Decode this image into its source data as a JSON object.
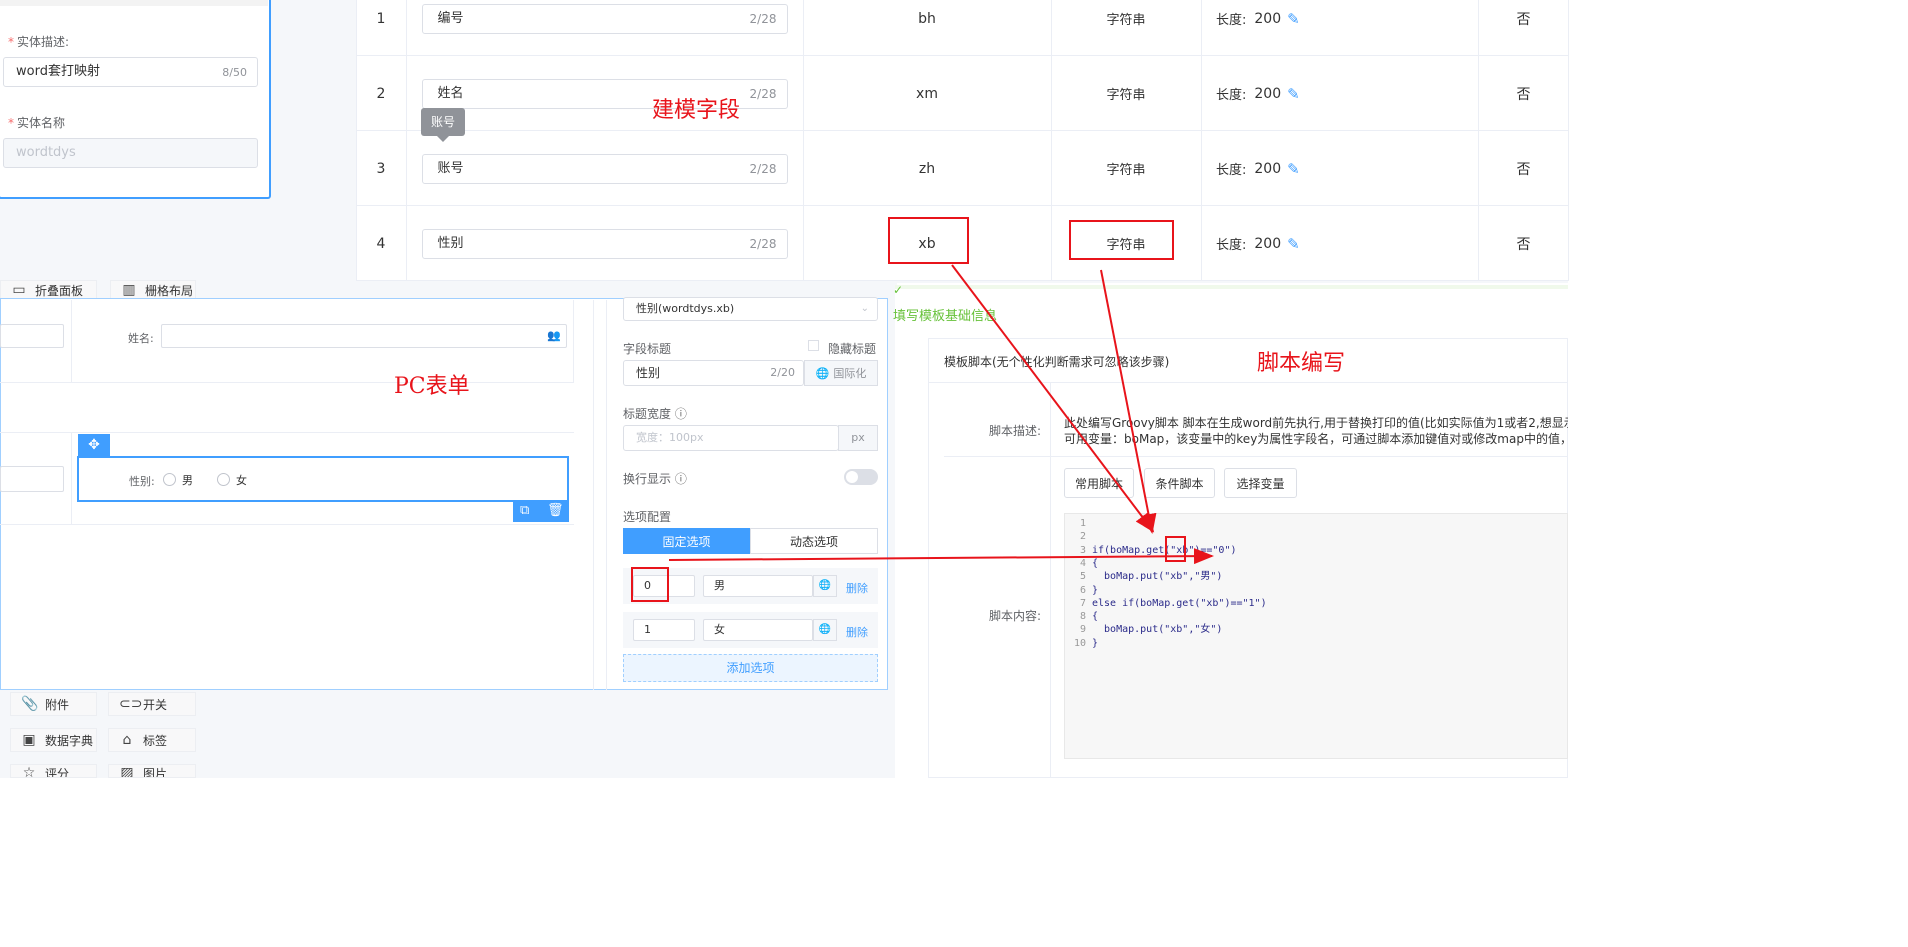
{
  "entity": {
    "desc_label": "实体描述:",
    "desc_value": "word套打映射",
    "desc_count": "8/50",
    "name_label": "实体名称",
    "name_value": "wordtdys"
  },
  "fields": {
    "rows": [
      {
        "index": "1",
        "label": "编号",
        "count": "2/28",
        "code": "bh",
        "type": "字符串",
        "length_label": "长度:",
        "length": "200",
        "required": "否"
      },
      {
        "index": "2",
        "label": "姓名",
        "count": "2/28",
        "code": "xm",
        "type": "字符串",
        "length_label": "长度:",
        "length": "200",
        "required": "否"
      },
      {
        "index": "3",
        "label": "账号",
        "count": "2/28",
        "code": "zh",
        "type": "字符串",
        "length_label": "长度:",
        "length": "200",
        "required": "否"
      },
      {
        "index": "4",
        "label": "性别",
        "count": "2/28",
        "code": "xb",
        "type": "字符串",
        "length_label": "长度:",
        "length": "200",
        "required": "否"
      }
    ],
    "tooltip": "账号"
  },
  "annotations": {
    "modeling": "建模字段",
    "pc_form": "PC表单",
    "script": "脚本编写"
  },
  "designer": {
    "components_top": [
      "折叠面板",
      "栅格布局"
    ],
    "components_bottom": [
      "附件",
      "开关",
      "数据字典",
      "标签",
      "评分",
      "图片"
    ],
    "name_label": "姓名:",
    "gender_label": "性别:",
    "radio_options": [
      "男",
      "女"
    ]
  },
  "props": {
    "bound_field": "性别(wordtdys.xb)",
    "field_title_label": "字段标题",
    "hide_title_label": "隐藏标题",
    "field_title_value": "性别",
    "field_title_count": "2/20",
    "i18n": "国际化",
    "title_width_label": "标题宽度",
    "title_width_placeholder": "宽度：100px",
    "unit": "px",
    "wrap_label": "换行显示",
    "options_label": "选项配置",
    "tab_fixed": "固定选项",
    "tab_dynamic": "动态选项",
    "options": [
      {
        "value": "0",
        "label": "男",
        "delete": "删除"
      },
      {
        "value": "1",
        "label": "女",
        "delete": "删除"
      }
    ],
    "add_option": "添加选项"
  },
  "script": {
    "step_title": "填写模板基础信息",
    "card_title": "模板脚本(无个性化判断需求可忽略该步骤)",
    "desc_label": "脚本描述:",
    "desc_line1": "此处编写Groovy脚本 脚本在生成word前先执行,用于替换打印的值(比如实际值为1或者2,想显示的值",
    "desc_line2": "可用变量：boMap，该变量中的key为属性字段名，可通过脚本添加键值对或修改map中的值，如：",
    "buttons": [
      "常用脚本",
      "条件脚本",
      "选择变量"
    ],
    "content_label": "脚本内容:",
    "code": [
      {
        "n": "1",
        "t": ""
      },
      {
        "n": "2",
        "t": ""
      },
      {
        "n": "3",
        "t": "if(boMap.get(\"xb\")==\"0\")"
      },
      {
        "n": "4",
        "t": "{"
      },
      {
        "n": "5",
        "t": "  boMap.put(\"xb\",\"男\")"
      },
      {
        "n": "6",
        "t": "}"
      },
      {
        "n": "7",
        "t": "else if(boMap.get(\"xb\")==\"1\")"
      },
      {
        "n": "8",
        "t": "{"
      },
      {
        "n": "9",
        "t": "  boMap.put(\"xb\",\"女\")"
      },
      {
        "n": "10",
        "t": "}"
      }
    ]
  },
  "colors": {
    "accent": "#409eff",
    "annotation": "#e8141b",
    "success": "#67c23a"
  }
}
